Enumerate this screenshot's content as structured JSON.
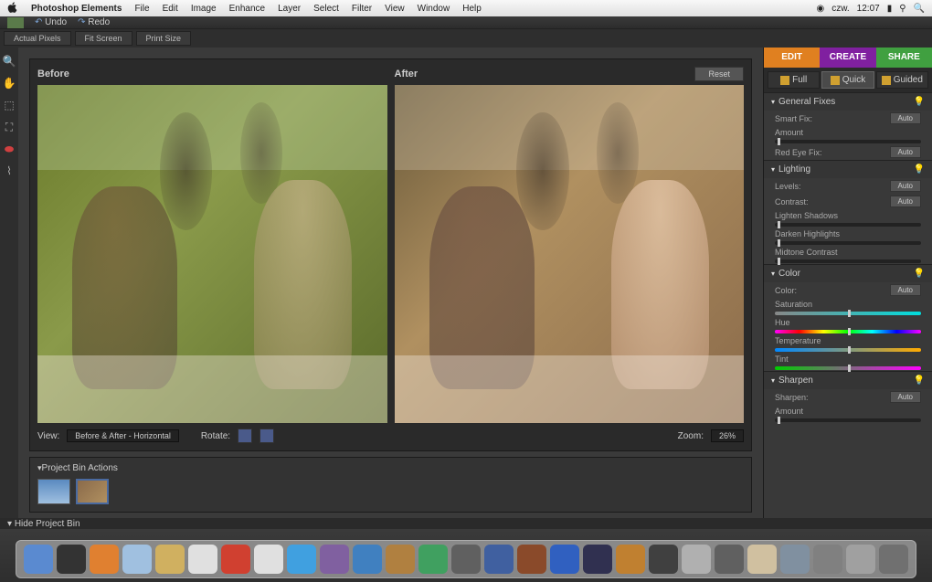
{
  "menubar": {
    "app_name": "Photoshop Elements",
    "items": [
      "File",
      "Edit",
      "Image",
      "Enhance",
      "Layer",
      "Select",
      "Filter",
      "View",
      "Window",
      "Help"
    ],
    "status_day": "czw.",
    "status_time": "12:07"
  },
  "appbar": {
    "undo": "Undo",
    "redo": "Redo"
  },
  "toolbar": {
    "actual": "Actual Pixels",
    "fit": "Fit Screen",
    "print": "Print Size"
  },
  "viewer": {
    "before": "Before",
    "after": "After",
    "reset": "Reset",
    "view_lbl": "View:",
    "view_mode": "Before & After - Horizontal",
    "rotate_lbl": "Rotate:",
    "zoom_lbl": "Zoom:",
    "zoom_val": "26%"
  },
  "bin": {
    "header": "Project Bin Actions"
  },
  "tabs": {
    "edit": "EDIT",
    "create": "CREATE",
    "share": "SHARE"
  },
  "modes": {
    "full": "Full",
    "quick": "Quick",
    "guided": "Guided"
  },
  "panels": {
    "general": {
      "title": "General Fixes",
      "smart": "Smart Fix:",
      "amount": "Amount",
      "redeye": "Red Eye Fix:",
      "auto": "Auto"
    },
    "lighting": {
      "title": "Lighting",
      "levels": "Levels:",
      "contrast": "Contrast:",
      "lighten": "Lighten Shadows",
      "darken": "Darken Highlights",
      "midtone": "Midtone Contrast",
      "auto": "Auto"
    },
    "color": {
      "title": "Color",
      "color": "Color:",
      "saturation": "Saturation",
      "hue": "Hue",
      "temperature": "Temperature",
      "tint": "Tint",
      "auto": "Auto"
    },
    "sharpen": {
      "title": "Sharpen",
      "sharpen": "Sharpen:",
      "amount": "Amount",
      "auto": "Auto"
    }
  },
  "footer": {
    "hide": "Hide Project Bin"
  },
  "dock_colors": [
    "#5a8ad0",
    "#333",
    "#e08030",
    "#a0c0e0",
    "#d0b060",
    "#e0e0e0",
    "#d04030",
    "#e0e0e0",
    "#40a0e0",
    "#8060a0",
    "#4080c0",
    "#b08040",
    "#40a060",
    "#606060",
    "#4060a0",
    "#8a4a2a",
    "#3060c0",
    "#303050",
    "#c08030",
    "#404040",
    "#b0b0b0",
    "#606060",
    "#d0c0a0",
    "#8090a0",
    "#808080",
    "#a0a0a0",
    "#707070"
  ]
}
